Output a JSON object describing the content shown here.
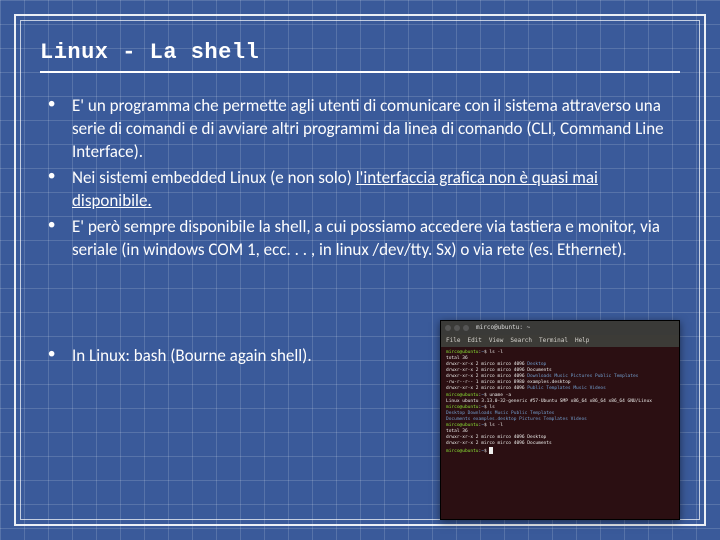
{
  "title": "Linux - La shell",
  "bullets": {
    "b1": "E' un programma che permette agli utenti di comunicare con il sistema attraverso una serie di comandi e di avviare altri programmi da linea di comando (CLI, Command Line Interface).",
    "b2a": "Nei sistemi embedded Linux (e non solo) ",
    "b2u": "l'interfaccia grafica non è quasi mai disponibile.",
    "b3": "E' però sempre disponibile la shell, a cui possiamo accedere via tastiera e monitor, via seriale (in windows COM 1, ecc. . . , in linux /dev/tty. Sx) o via rete (es. Ethernet).",
    "b4": "In Linux: bash (Bourne again shell)."
  },
  "terminal": {
    "title_user": "mirco@ubuntu: ~",
    "menu": [
      "File",
      "Edit",
      "View",
      "Search",
      "Terminal",
      "Help"
    ],
    "prompt_user": "mirco@ubuntu",
    "prompt_path": "~",
    "lines": {
      "l0": "$ ls -l",
      "l1": "total 36",
      "l2_pre": "drwxr-xr-x 2 mirco mirco 4096 ",
      "l2_dir": "Desktop",
      "l3": "drwxr-xr-x 2 mirco mirco 4096 Documents",
      "l4_pre": "drwxr-xr-x 2 mirco mirco 4096 ",
      "l4_dirs": "Downloads  Music  Pictures  Public  Templates",
      "l5_pre": "-rw-r--r-- 1 mirco mirco 8980 ",
      "l5_file": "examples.desktop",
      "l6_pre": "drwxr-xr-x 2 mirco mirco 4096 ",
      "l6_dirs": "Public  Templates  Music  Videos",
      "l7": "$ uname -a",
      "l8": "Linux ubuntu 3.13.0-32-generic #57-Ubuntu SMP x86_64 x86_64 x86_64 GNU/Linux",
      "l9": "$ ls",
      "l10_a": "Desktop    Downloads         Music     Public     Templates",
      "l10_b": "Documents  examples.desktop  Pictures  Templates  Videos",
      "l11": "$ ls -l",
      "l12": "total 36",
      "l13": "drwxr-xr-x 2 mirco mirco 4096 Desktop",
      "l14": "drwxr-xr-x 2 mirco mirco 4096 Documents",
      "l15": "$ "
    }
  }
}
